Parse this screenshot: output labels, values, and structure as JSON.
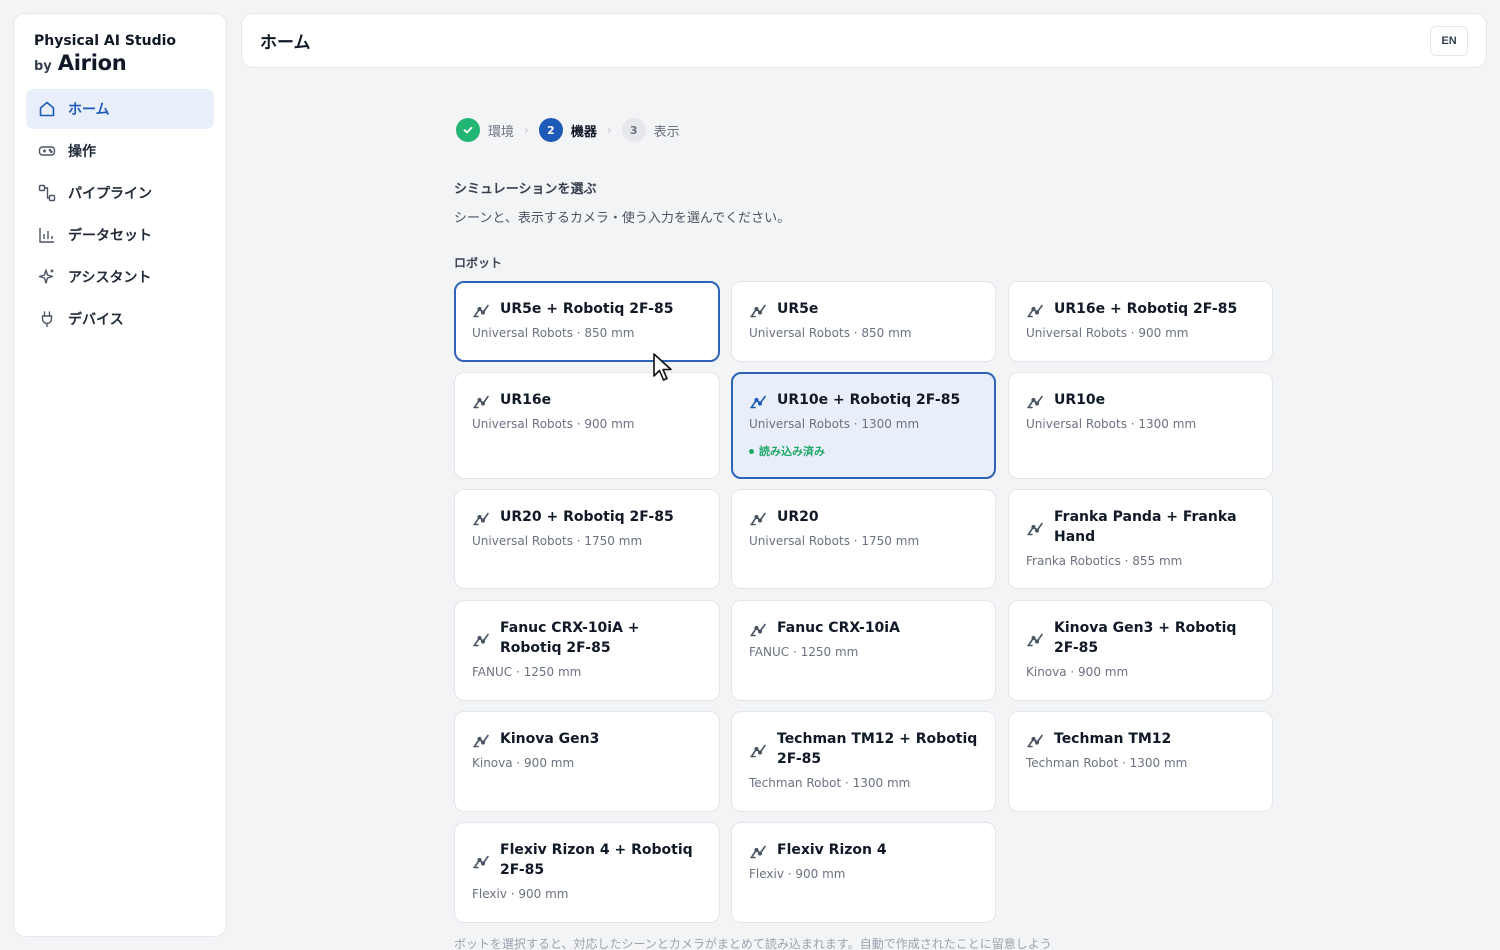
{
  "sidebar": {
    "brand_title": "Physical AI Studio",
    "brand_by": "by",
    "brand_name": "Airion",
    "items": [
      {
        "label": "ホーム",
        "icon": "home-icon",
        "active": true
      },
      {
        "label": "操作",
        "icon": "gamepad-icon"
      },
      {
        "label": "パイプライン",
        "icon": "pipeline-icon"
      },
      {
        "label": "データセット",
        "icon": "bar-chart-icon"
      },
      {
        "label": "アシスタント",
        "icon": "sparkle-icon"
      },
      {
        "label": "デバイス",
        "icon": "plug-icon"
      }
    ]
  },
  "header": {
    "title": "ホーム",
    "lang": "EN"
  },
  "stepper": {
    "steps": [
      {
        "number": "1",
        "label": "環境",
        "state": "done"
      },
      {
        "number": "2",
        "label": "機器",
        "state": "current"
      },
      {
        "number": "3",
        "label": "表示",
        "state": "todo"
      }
    ]
  },
  "main": {
    "section_title": "シミュレーションを選ぶ",
    "section_desc": "シーンと、表示するカメラ・使う入力を選んでください。",
    "group_label": "ロボット",
    "footer_text": "ボットを選択すると、対応したシーンとカメラがまとめて読み込まれます。自動で作成されたことに留意しよう"
  },
  "robots": [
    {
      "name": "UR5e + Robotiq 2F-85",
      "meta": "Universal Robots · 850 mm",
      "state": "hover"
    },
    {
      "name": "UR5e",
      "meta": "Universal Robots · 850 mm"
    },
    {
      "name": "UR16e + Robotiq 2F-85",
      "meta": "Universal Robots · 900 mm"
    },
    {
      "name": "UR16e",
      "meta": "Universal Robots · 900 mm"
    },
    {
      "name": "UR10e + Robotiq 2F-85",
      "meta": "Universal Robots · 1300 mm",
      "state": "selected",
      "status": "読み込み済み"
    },
    {
      "name": "UR10e",
      "meta": "Universal Robots · 1300 mm"
    },
    {
      "name": "UR20 + Robotiq 2F-85",
      "meta": "Universal Robots · 1750 mm"
    },
    {
      "name": "UR20",
      "meta": "Universal Robots · 1750 mm"
    },
    {
      "name": "Franka Panda + Franka Hand",
      "meta": "Franka Robotics · 855 mm"
    },
    {
      "name": "Fanuc CRX-10iA + Robotiq 2F-85",
      "meta": "FANUC · 1250 mm"
    },
    {
      "name": "Fanuc CRX-10iA",
      "meta": "FANUC · 1250 mm"
    },
    {
      "name": "Kinova Gen3 + Robotiq 2F-85",
      "meta": "Kinova · 900 mm"
    },
    {
      "name": "Kinova Gen3",
      "meta": "Kinova · 900 mm"
    },
    {
      "name": "Techman TM12 + Robotiq 2F-85",
      "meta": "Techman Robot · 1300 mm"
    },
    {
      "name": "Techman TM12",
      "meta": "Techman Robot · 1300 mm"
    },
    {
      "name": "Flexiv Rizon 4 + Robotiq 2F-85",
      "meta": "Flexiv · 900 mm"
    },
    {
      "name": "Flexiv Rizon 4",
      "meta": "Flexiv · 900 mm"
    }
  ],
  "colors": {
    "accent": "#1e5bb8",
    "success": "#22b573",
    "selected_bg": "#e9effa"
  }
}
